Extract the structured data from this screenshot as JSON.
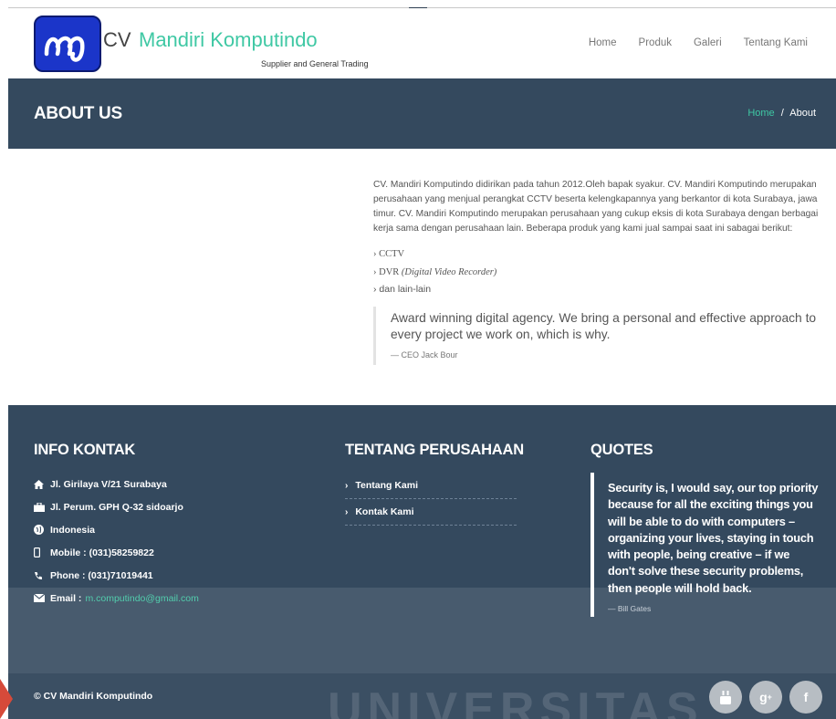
{
  "header": {
    "brand_prefix": "CV",
    "brand_name": "Mandiri Komputindo",
    "tagline": "Supplier and General Trading",
    "nav": [
      "Home",
      "Produk",
      "Galeri",
      "Tentang Kami"
    ]
  },
  "title_band": {
    "title": "ABOUT US",
    "breadcrumb_home": "Home",
    "breadcrumb_sep": "/",
    "breadcrumb_current": "About"
  },
  "content": {
    "paragraph": "CV. Mandiri Komputindo didirikan pada tahun 2012.Oleh bapak syakur. CV. Mandiri Komputindo merupakan perusahaan yang menjual perangkat CCTV beserta kelengkapannya yang berkantor di kota Surabaya, jawa timur. CV. Mandiri Komputindo merupakan perusahaan yang cukup eksis di kota Surabaya dengan berbagai kerja sama dengan perusahaan lain. Beberapa produk yang kami jual sampai saat ini sabagai berikut:",
    "list": {
      "item1": "› CCTV",
      "item2_prefix": "› DVR ",
      "item2_italic": "(Digital Video Recorder)",
      "item3": "›   dan lain-lain"
    },
    "quote_text": "Award winning digital agency. We bring a personal and effective approach to every project we work on, which is why.",
    "quote_author": "— CEO Jack Bour"
  },
  "footer": {
    "contact_heading": "INFO KONTAK",
    "contacts": [
      "Jl. Girilaya V/21 Surabaya",
      "Jl. Perum. GPH Q-32 sidoarjo",
      "Indonesia",
      "Mobile : (031)58259822",
      "Phone : (031)71019441"
    ],
    "email_label": "Email :",
    "email_value": "m.computindo@gmail.com",
    "company_heading": "TENTANG PERUSAHAAN",
    "company_links": [
      "Tentang Kami",
      "Kontak Kami"
    ],
    "quotes_heading": "QUOTES",
    "quote_text": "Security is, I would say, our top priority because for all the exciting things you will be able to do with computers – organizing your lives, staying in touch with people, being creative – if we don't solve these security problems, then people will hold back.",
    "quote_author": "— Bill Gates"
  },
  "bottom": {
    "copyright": "© CV Mandiri Komputindo",
    "watermark": "UNIVERSITAS",
    "socials": [
      "youtube-icon",
      "google-plus-icon",
      "facebook-icon"
    ]
  },
  "colors": {
    "accent": "#3fc8a4",
    "band": "#34495e",
    "logo_blue": "#1b35c9"
  }
}
